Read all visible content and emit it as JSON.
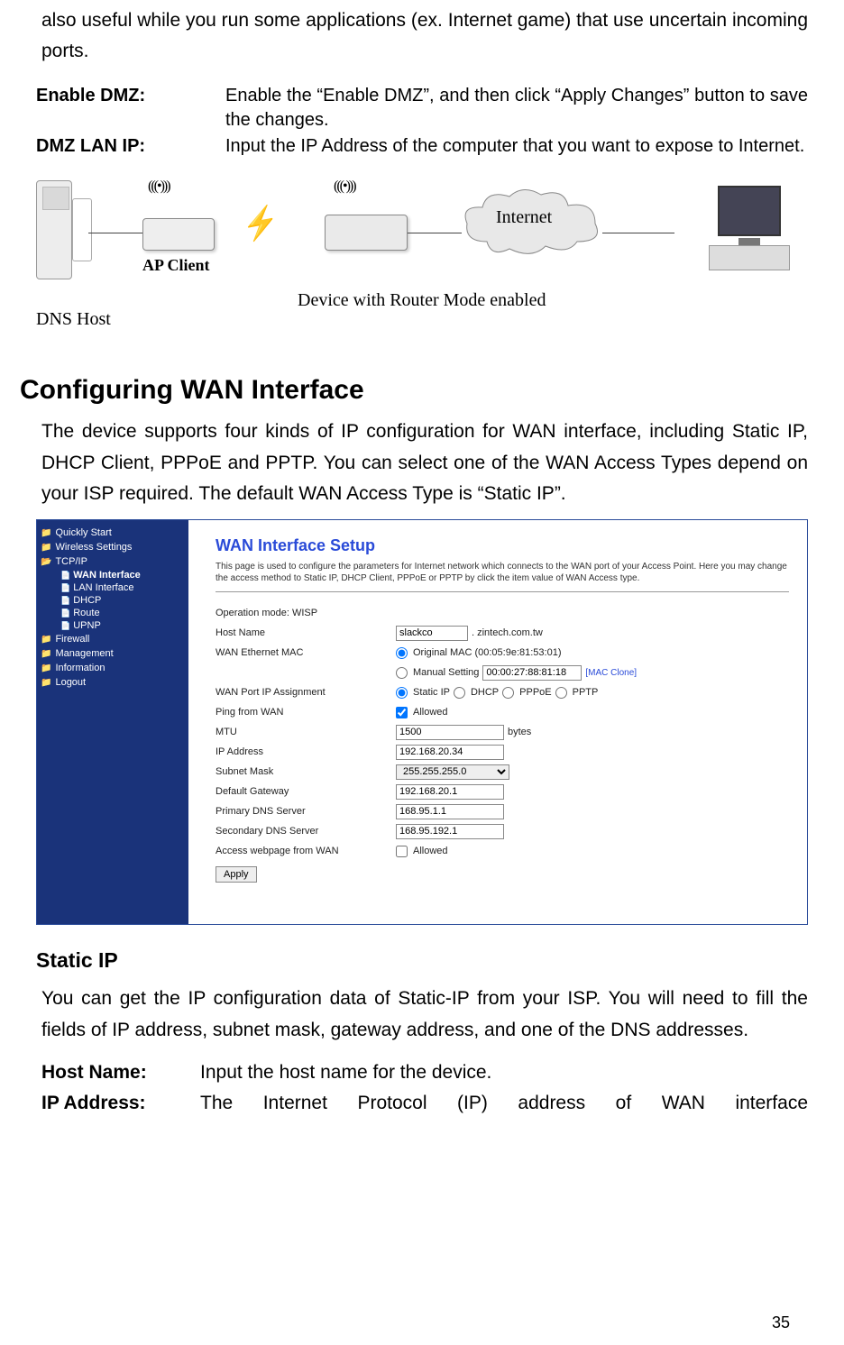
{
  "intro": "also useful while you run some applications (ex. Internet game) that use uncertain incoming ports.",
  "defs": {
    "dmz_label": "Enable DMZ:",
    "dmz_text": "Enable the “Enable DMZ”, and then click “Apply Changes” button to save the changes.",
    "dmzip_label": "DMZ LAN IP:",
    "dmzip_text": "Input the IP Address of the computer that you want to expose to Internet."
  },
  "diagram": {
    "dns": "DNS Host",
    "ap": "AP Client",
    "router": "Device with Router Mode enabled",
    "internet": "Internet",
    "waves": "(((•)))"
  },
  "section_title": "Configuring WAN Interface",
  "section_body": "The device supports four kinds of IP configuration for WAN interface, including Static IP, DHCP Client, PPPoE and PPTP. You can select one of the WAN Access Types depend on your ISP required. The default WAN Access Type is “Static IP”.",
  "screenshot": {
    "nav": {
      "quickly": "Quickly Start",
      "wireless": "Wireless Settings",
      "tcpip": "TCP/IP",
      "wan": "WAN Interface",
      "lan": "LAN Interface",
      "dhcp": "DHCP",
      "route": "Route",
      "upnp": "UPNP",
      "firewall": "Firewall",
      "mgmt": "Management",
      "info": "Information",
      "logout": "Logout"
    },
    "title": "WAN Interface Setup",
    "desc": "This page is used to configure the parameters for Internet network which connects to the WAN port of your Access Point. Here you may change the access method to Static IP, DHCP Client, PPPoE or PPTP by click the item value of WAN Access type.",
    "opmode_label": "Operation mode: WISP",
    "hostname_label": "Host Name",
    "hostname_val": "slackco",
    "hostname_suffix": ". zintech.com.tw",
    "wanmac_label": "WAN Ethernet MAC",
    "origmac_label": "Original MAC (00:05:9e:81:53:01)",
    "manual_label": "Manual Setting",
    "manual_val": "00:00:27:88:81:18",
    "macclone": "[MAC Clone]",
    "wanport_label": "WAN Port IP Assignment",
    "staticip": "Static IP",
    "dhcp_r": "DHCP",
    "pppoe": "PPPoE",
    "pptp": "PPTP",
    "ping_label": "Ping from WAN",
    "allowed": "Allowed",
    "mtu_label": "MTU",
    "mtu_val": "1500",
    "bytes": "bytes",
    "ip_label": "IP Address",
    "ip_val": "192.168.20.34",
    "subnet_label": "Subnet Mask",
    "subnet_val": "255.255.255.0",
    "gw_label": "Default Gateway",
    "gw_val": "192.168.20.1",
    "pdns_label": "Primary DNS Server",
    "pdns_val": "168.95.1.1",
    "sdns_label": "Secondary DNS Server",
    "sdns_val": "168.95.192.1",
    "webpage_label": "Access webpage from WAN",
    "apply": "Apply"
  },
  "sub_title": "Static IP",
  "sub_body": "You can get the IP configuration data of Static-IP from your ISP. You will need to fill the fields of IP address, subnet mask, gateway address, and one of the DNS addresses.",
  "defs2": {
    "host_label": "Host Name:",
    "host_text": "Input the host name for the device.",
    "ip_label": "IP Address:",
    "ip_text": "The Internet Protocol (IP) address of WAN interface"
  },
  "page_number": "35"
}
